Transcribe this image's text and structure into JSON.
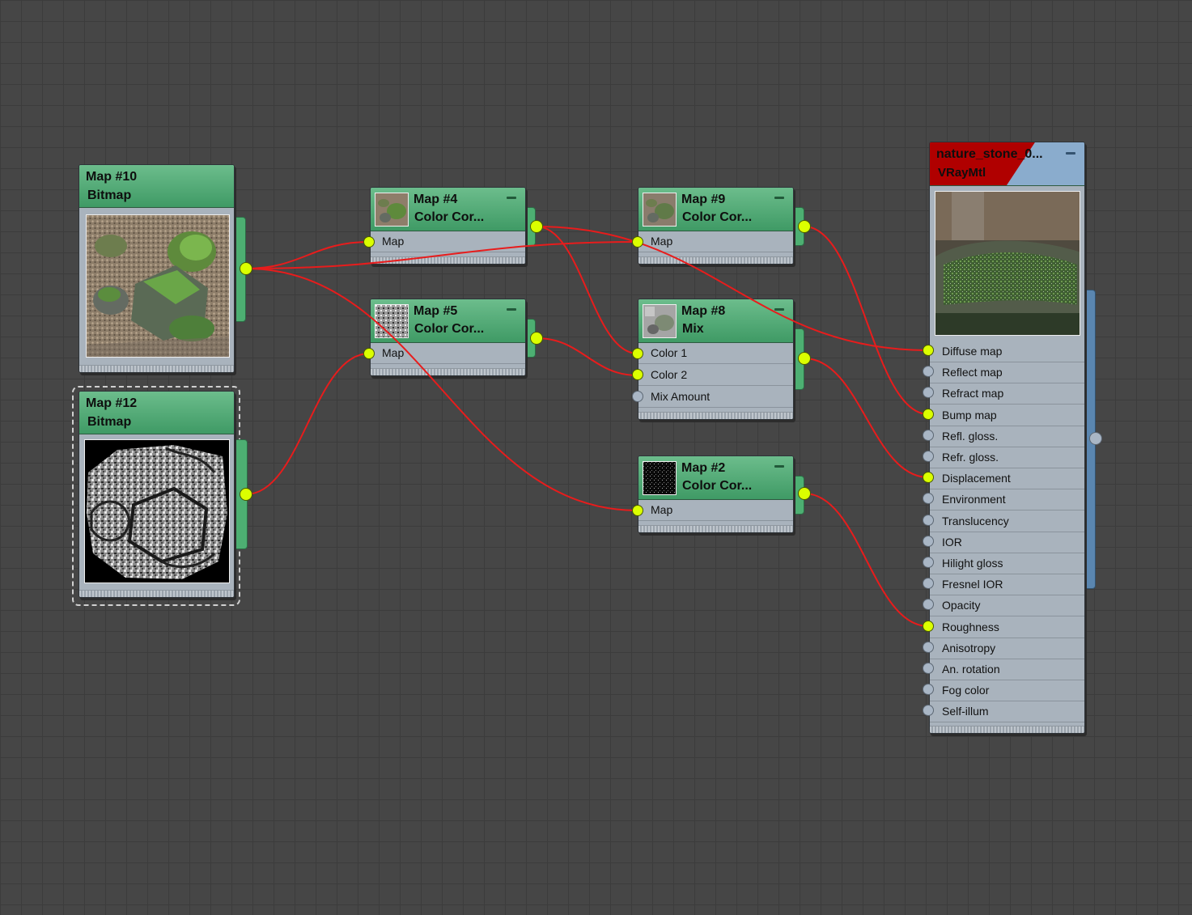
{
  "nodes": {
    "map10": {
      "title": "Map #10",
      "type": "Bitmap"
    },
    "map12": {
      "title": "Map #12",
      "type": "Bitmap"
    },
    "map4": {
      "title": "Map #4",
      "type": "Color Cor...",
      "slots": [
        "Map"
      ]
    },
    "map5": {
      "title": "Map #5",
      "type": "Color Cor...",
      "slots": [
        "Map"
      ]
    },
    "map9": {
      "title": "Map #9",
      "type": "Color Cor...",
      "slots": [
        "Map"
      ]
    },
    "map8": {
      "title": "Map #8",
      "type": "Mix",
      "slots": [
        "Color 1",
        "Color 2",
        "Mix Amount"
      ]
    },
    "map2": {
      "title": "Map #2",
      "type": "Color Cor...",
      "slots": [
        "Map"
      ]
    },
    "material": {
      "title": "nature_stone_0...",
      "type": "VRayMtl",
      "slots": [
        "Diffuse map",
        "Reflect map",
        "Refract map",
        "Bump map",
        "Refl. gloss.",
        "Refr. gloss.",
        "Displacement",
        "Environment",
        "Translucency",
        "IOR",
        "Hilight gloss",
        "Fresnel IOR",
        "Opacity",
        "Roughness",
        "Anisotropy",
        "An. rotation",
        "Fog color",
        "Self-illum"
      ],
      "connected_slots": [
        "Diffuse map",
        "Bump map",
        "Displacement",
        "Roughness"
      ]
    }
  },
  "colors": {
    "header_green": "#4daf72",
    "wire_red": "#e81c1c",
    "port_connected": "#dbff00",
    "port_empty": "#a9b6c5",
    "material_header": "#b00000",
    "material_accent": "#5a86b0"
  },
  "connections": [
    {
      "from": "Map #10",
      "to": "Map #4 / Map"
    },
    {
      "from": "Map #10",
      "to": "Map #9 / Map"
    },
    {
      "from": "Map #10",
      "to": "Map #2 / Map"
    },
    {
      "from": "Map #12",
      "to": "Map #5 / Map"
    },
    {
      "from": "Map #4",
      "to": "Map #8 / Color 1"
    },
    {
      "from": "Map #4",
      "to": "nature_stone_0... / Diffuse map"
    },
    {
      "from": "Map #5",
      "to": "Map #8 / Color 2"
    },
    {
      "from": "Map #9",
      "to": "nature_stone_0... / Bump map"
    },
    {
      "from": "Map #8",
      "to": "nature_stone_0... / Displacement"
    },
    {
      "from": "Map #2",
      "to": "nature_stone_0... / Roughness"
    }
  ]
}
